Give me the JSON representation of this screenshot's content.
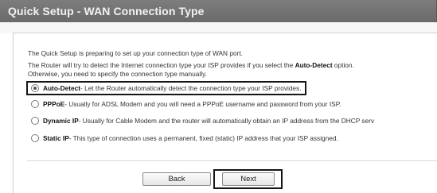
{
  "header": {
    "title": "Quick Setup - WAN Connection Type"
  },
  "intro": {
    "line1": "The Quick Setup is preparing to set up your connection type of WAN port.",
    "line2_before": "The Router will try to detect the Internet connection type your ISP provides if you select the ",
    "line2_bold": "Auto-Detect",
    "line2_after": " option.",
    "line3": "Otherwise, you need to specify the connection type manually."
  },
  "options": [
    {
      "name": "Auto-Detect",
      "desc": " - Let the Router automatically detect the connection type your ISP provides.",
      "selected": true
    },
    {
      "name": "PPPoE",
      "desc": " - Usually for ADSL Modem and you will need a PPPoE username and password from your ISP.",
      "selected": false
    },
    {
      "name": "Dynamic IP",
      "desc": " - Usually for Cable Modem and the router will automatically obtain an IP address from the DHCP serv",
      "selected": false
    },
    {
      "name": "Static IP",
      "desc": " - This type of connection uses a permanent, fixed (static) IP address that your ISP assigned.",
      "selected": false
    }
  ],
  "buttons": {
    "back": "Back",
    "next": "Next"
  }
}
